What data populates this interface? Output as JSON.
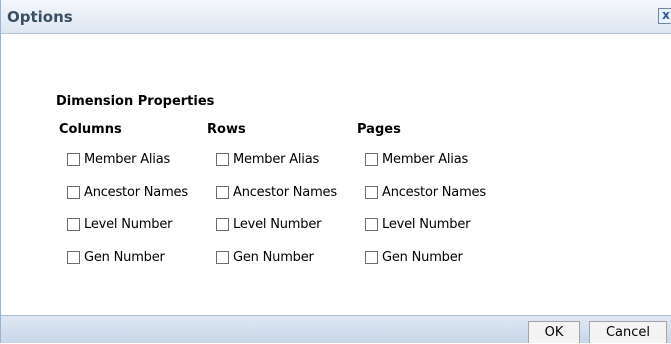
{
  "dialog": {
    "title": "Options",
    "close_glyph": "x"
  },
  "section_title": "Dimension Properties",
  "columns": [
    {
      "heading": "Columns",
      "options": [
        "Member Alias",
        "Ancestor Names",
        "Level Number",
        "Gen Number"
      ]
    },
    {
      "heading": "Rows",
      "options": [
        "Member Alias",
        "Ancestor Names",
        "Level Number",
        "Gen Number"
      ]
    },
    {
      "heading": "Pages",
      "options": [
        "Member Alias",
        "Ancestor Names",
        "Level Number",
        "Gen Number"
      ]
    }
  ],
  "footer": {
    "ok_label": "OK",
    "cancel_label": "Cancel"
  }
}
